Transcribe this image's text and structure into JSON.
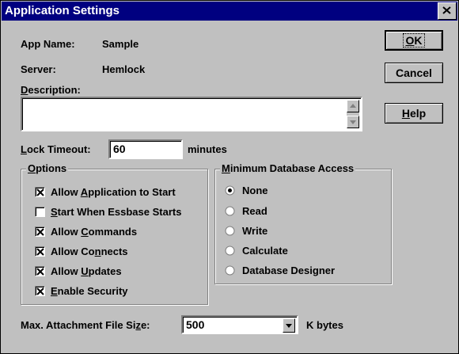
{
  "window": {
    "title": "Application Settings"
  },
  "app_name": {
    "label": "App Name:",
    "value": "Sample"
  },
  "server": {
    "label": "Server:",
    "value": "Hemlock"
  },
  "description": {
    "label_first": "D",
    "label_rest": "escription:",
    "value": ""
  },
  "lock_timeout": {
    "label_first": "L",
    "label_rest": "ock Timeout:",
    "value": "60",
    "unit": "minutes"
  },
  "buttons": {
    "ok": {
      "pre": "",
      "under": "O",
      "post": "K"
    },
    "cancel": {
      "label": "Cancel"
    },
    "help": {
      "pre": "",
      "under": "H",
      "post": "elp"
    }
  },
  "options": {
    "title_first": "O",
    "title_rest": "ptions",
    "items": [
      {
        "pre": "Allow ",
        "under": "A",
        "post": "pplication to Start",
        "checked": true
      },
      {
        "pre": "",
        "under": "S",
        "post": "tart When Essbase Starts",
        "checked": false
      },
      {
        "pre": "Allow ",
        "under": "C",
        "post": "ommands",
        "checked": true
      },
      {
        "pre": "Allow Co",
        "under": "n",
        "post": "nects",
        "checked": true
      },
      {
        "pre": "Allow ",
        "under": "U",
        "post": "pdates",
        "checked": true
      },
      {
        "pre": "",
        "under": "E",
        "post": "nable Security",
        "checked": true
      }
    ]
  },
  "min_access": {
    "title_first": "M",
    "title_rest": "inimum Database Access",
    "items": [
      {
        "label": "None",
        "selected": true
      },
      {
        "label": "Read",
        "selected": false
      },
      {
        "label": "Write",
        "selected": false
      },
      {
        "label": "Calculate",
        "selected": false
      },
      {
        "label": "Database Designer",
        "selected": false
      }
    ]
  },
  "attachment": {
    "label_pre": "Max. Attachment File Si",
    "label_under": "z",
    "label_post": "e:",
    "value": "500",
    "unit": "K bytes"
  }
}
